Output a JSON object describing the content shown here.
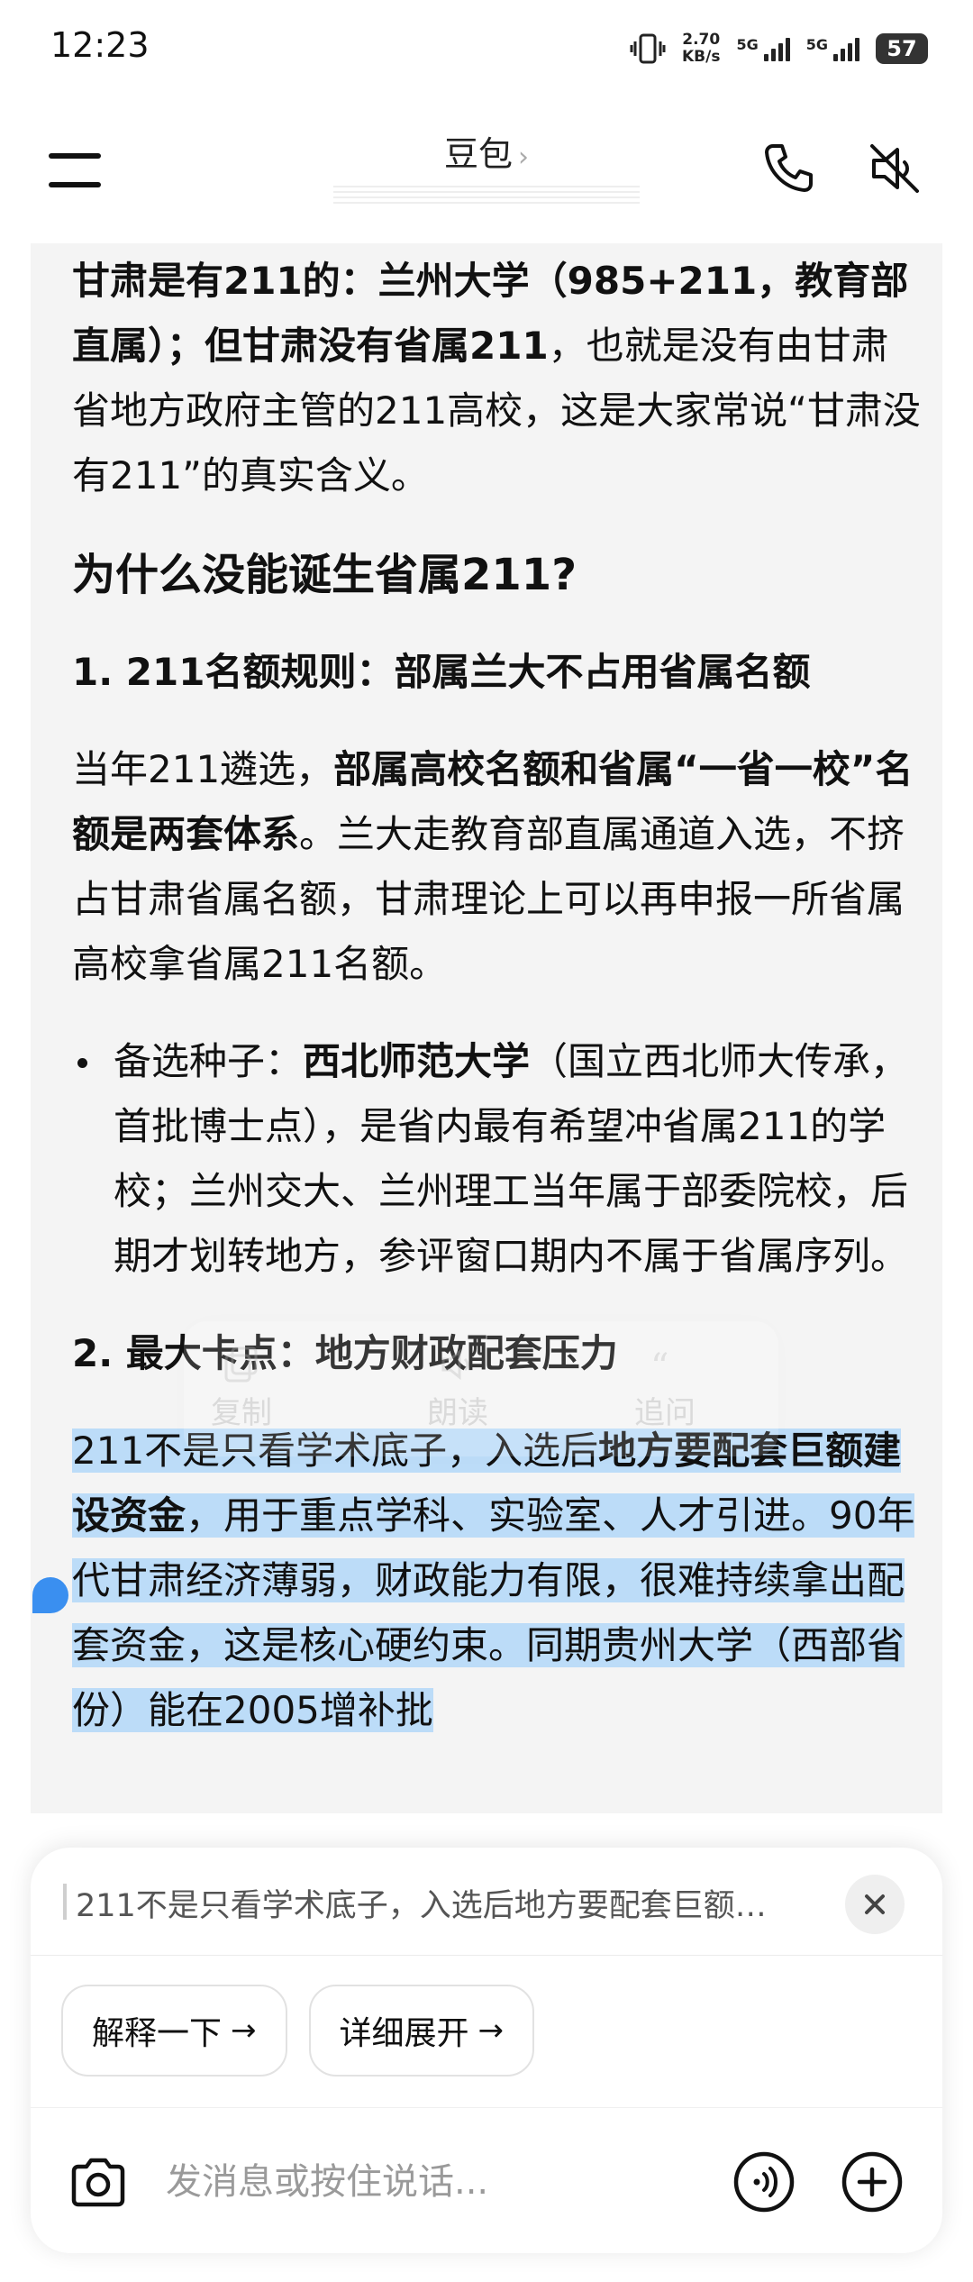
{
  "status_bar": {
    "time": "12:23",
    "net_speed_value": "2.70",
    "net_speed_unit": "KB/s",
    "signal_1_label": "5G",
    "signal_2_label": "5G",
    "battery": "57"
  },
  "header": {
    "title": "豆包",
    "title_chevron": "›"
  },
  "article": {
    "p1_bold_a": "甘肃是有211的：兰州大学（985+211，教育部直属）；但甘肃没有省属211",
    "p1_rest": "，也就是没有由甘肃省地方政府主管的211高校，这是大家常说“甘肃没有211”的真实含义。",
    "h2": "为什么没能诞生省属211?",
    "h3_1": "1. 211名额规则：部属兰大不占用省属名额",
    "p2_a": "当年211遴选，",
    "p2_bold": "部属高校名额和省属“一省一校”名额是两套体系",
    "p2_rest": "。兰大走教育部直属通道入选，不挤占甘肃省属名额，甘肃理论上可以再申报一所省属高校拿省属211名额。",
    "bullet_a": "备选种子：",
    "bullet_bold": "西北师范大学",
    "bullet_rest": "（国立西北师大传承，首批博士点），是省内最有希望冲省属211的学校；兰州交大、兰州理工当年属于部委院校，后期才划转地方，参评窗口期内不属于省属序列。",
    "h3_2": "2. 最大卡点：地方财政配套压力",
    "p3_a": "211不是只看学术底子，入选后",
    "p3_bold": "地方要配套巨额建设资金",
    "p3_rest": "，用于重点学科、实验室、人才引进。90年代甘肃经济薄弱，财政能力有限，很难持续拿出配套资金，这是核心硬约束。同期贵州大学（西部省份）能在2005增补批"
  },
  "float_toolbar": {
    "copy_label": "复制",
    "read_label": "朗读",
    "ask_label": "追问"
  },
  "bottom": {
    "quote_text": "211不是只看学术底子，入选后地方要配套巨额…",
    "chips": [
      {
        "label": "解释一下",
        "arrow": "→"
      },
      {
        "label": "详细展开",
        "arrow": "→"
      }
    ],
    "input_placeholder": "发消息或按住说话..."
  },
  "colors": {
    "highlight": "#bcdcf8",
    "selection_handle": "#3a8ff0",
    "chat_bg": "#f4f4f4"
  }
}
